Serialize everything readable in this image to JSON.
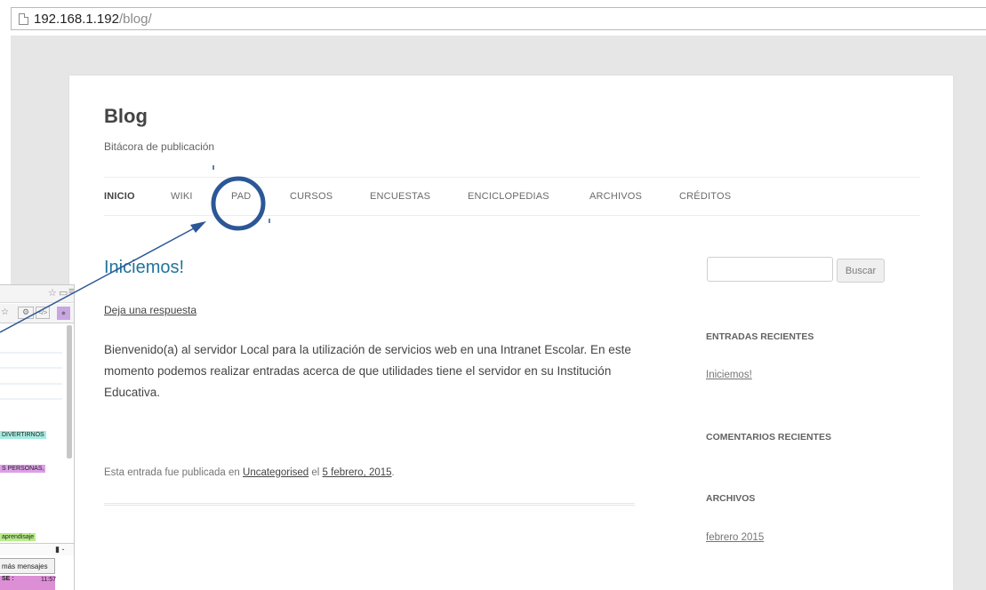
{
  "browser": {
    "url_host": "192.168.1.192",
    "url_path": "/blog/"
  },
  "site": {
    "title": "Blog",
    "description": "Bitácora de publicación"
  },
  "nav": {
    "items": [
      "INICIO",
      "WIKI",
      "PAD",
      "CURSOS",
      "ENCUESTAS",
      "ENCICLOPEDIAS",
      "ARCHIVOS",
      "CRÉDITOS"
    ],
    "active": "INICIO",
    "highlighted": "PAD"
  },
  "post": {
    "title": "Iniciemos!",
    "reply_link": "Deja una respuesta",
    "body": "Bienvenido(a) al servidor Local para la utilización de servicios web en una Intranet Escolar. En este momento podemos realizar entradas acerca de que utilidades tiene el servidor en su Institución Educativa.",
    "meta_prefix": "Esta entrada fue publicada en",
    "category": "Uncategorised",
    "meta_mid": "el",
    "date": "5 febrero, 2015",
    "meta_suffix": "."
  },
  "sidebar": {
    "search_button": "Buscar",
    "recent_posts_title": "ENTRADAS RECIENTES",
    "recent_posts": [
      "Iniciemos!"
    ],
    "recent_comments_title": "COMENTARIOS RECIENTES",
    "archives_title": "ARCHIVOS",
    "archives": [
      "febrero 2015"
    ]
  },
  "overlay": {
    "tags": [
      "DIVERTIRNOS",
      "S PERSONAS,",
      "aprendisaje"
    ],
    "more_button": "más mensajes",
    "chat_name": "SE :",
    "chat_time": "11:57"
  },
  "colors": {
    "link_blue": "#21759b",
    "annotation_blue": "#2b5797",
    "tag_teal": "#a6ece0",
    "tag_purple": "#dda0e8",
    "tag_green": "#b8ec8a"
  }
}
